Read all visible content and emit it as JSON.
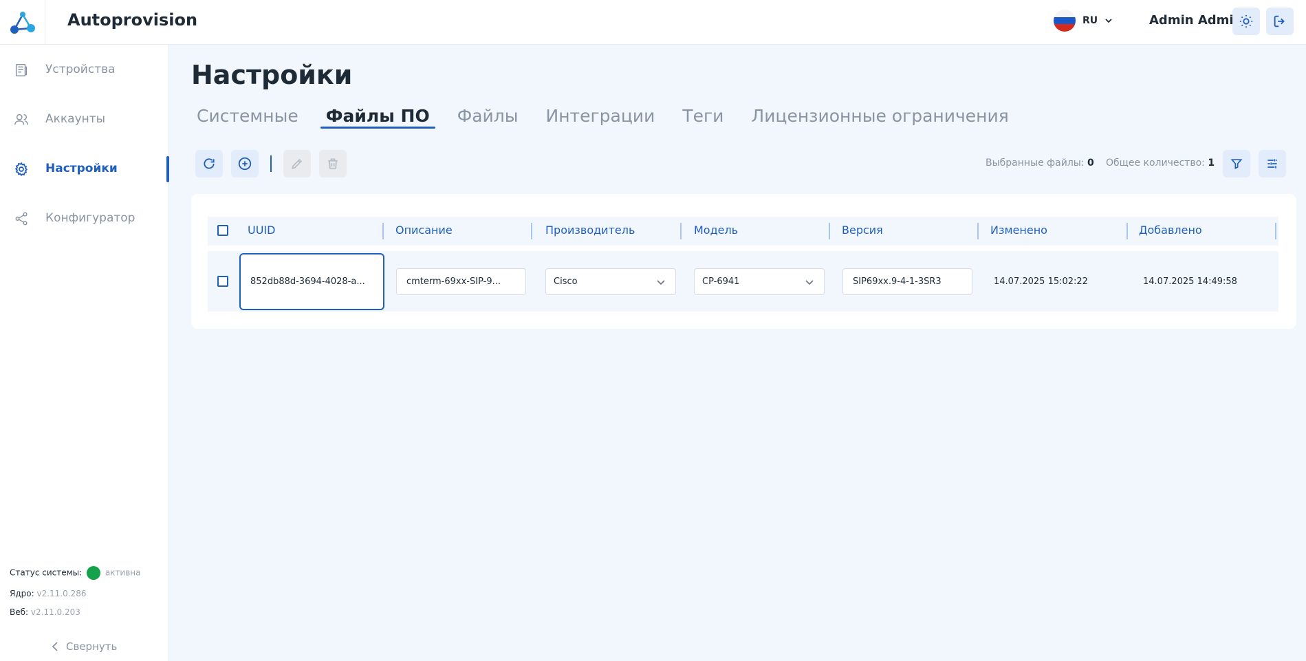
{
  "app": {
    "title": "Autoprovision"
  },
  "header": {
    "lang_code": "RU",
    "user_name": "Admin Admin"
  },
  "sidebar": {
    "items": [
      {
        "label": "Устройства",
        "icon": "devices-icon"
      },
      {
        "label": "Аккаунты",
        "icon": "users-icon"
      },
      {
        "label": "Настройки",
        "icon": "gear-icon",
        "active": true
      },
      {
        "label": "Конфигуратор",
        "icon": "share-icon"
      }
    ],
    "status": {
      "system_label": "Статус системы:",
      "system_value": "активна",
      "core_label": "Ядро:",
      "core_value": "v2.11.0.286",
      "web_label": "Веб:",
      "web_value": "v2.11.0.203"
    },
    "collapse_label": "Свернуть"
  },
  "main": {
    "title": "Настройки",
    "tabs": [
      "Системные",
      "Файлы ПО",
      "Файлы",
      "Интеграции",
      "Теги",
      "Лицензионные ограничения"
    ],
    "active_tab": "Файлы ПО",
    "counters": {
      "selected_label": "Выбранные файлы:",
      "selected_value": "0",
      "total_label": "Общее количество:",
      "total_value": "1"
    },
    "table": {
      "columns": [
        "UUID",
        "Описание",
        "Производитель",
        "Модель",
        "Версия",
        "Изменено",
        "Добавлено"
      ],
      "rows": [
        {
          "uuid": "852db88d-3694-4028-a...",
          "description": "cmterm-69xx-SIP-9...",
          "manufacturer": "Cisco",
          "model": "CP-6941",
          "version": "SIP69xx.9-4-1-3SR3",
          "modified": "14.07.2025 15:02:22",
          "added": "14.07.2025 14:49:58"
        }
      ]
    }
  },
  "colors": {
    "accent": "#1f5fbd",
    "background": "#f2f7fd",
    "status_active": "#14a34a"
  }
}
